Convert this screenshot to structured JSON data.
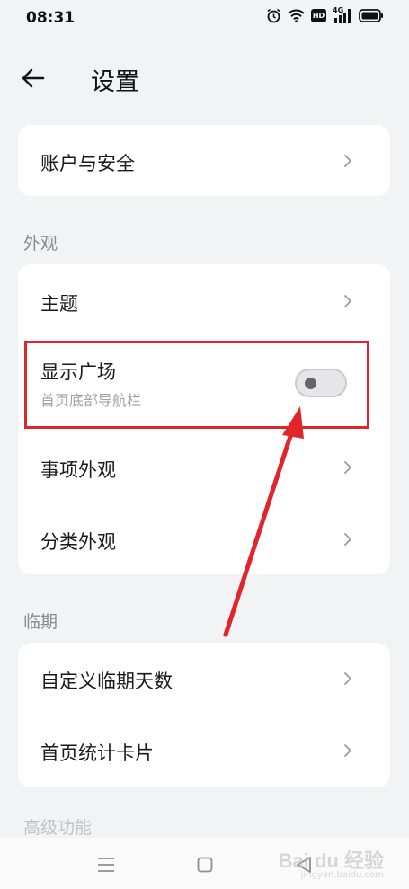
{
  "status_bar": {
    "time": "08:31",
    "icons": [
      "alarm-icon",
      "wifi-icon",
      "hd-icon",
      "signal-4g-icon",
      "battery-icon"
    ],
    "hd_label": "HD",
    "network_label": "4G"
  },
  "header": {
    "title": "设置",
    "back_icon": "arrow-left-icon"
  },
  "account_card": {
    "account_security": "账户与安全"
  },
  "appearance": {
    "section_label": "外观",
    "theme": "主题",
    "show_square": "显示广场",
    "show_square_sub": "首页底部导航栏",
    "show_square_enabled": false,
    "item_appearance": "事项外观",
    "category_appearance": "分类外观"
  },
  "expiry": {
    "section_label": "临期",
    "custom_days": "自定义临期天数",
    "home_stats_card": "首页统计卡片"
  },
  "partial_section_label": "高级功能",
  "bottom_nav": {
    "icons": [
      "menu-icon",
      "home-square-icon",
      "back-triangle-icon"
    ]
  },
  "watermark": {
    "text": "Bai du 经验",
    "url": "jingyan.baidu.com"
  },
  "colors": {
    "background": "#f2f3f5",
    "card": "#ffffff",
    "annotation_red": "#e0252b",
    "secondary_text": "#a3a3a3"
  }
}
